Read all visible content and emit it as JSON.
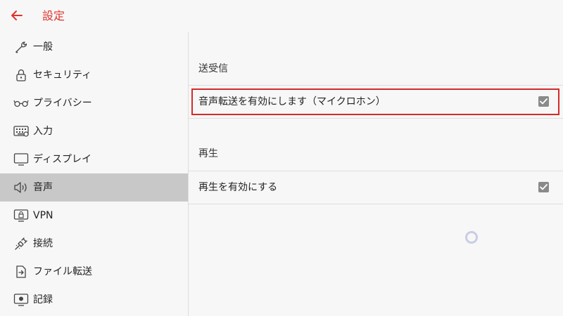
{
  "header": {
    "title": "設定",
    "back_icon": "arrow-left-icon",
    "accent_color": "#e0322b"
  },
  "sidebar": {
    "items": [
      {
        "label": "一般",
        "icon": "wrench-icon",
        "active": false
      },
      {
        "label": "セキュリティ",
        "icon": "lock-icon",
        "active": false
      },
      {
        "label": "プライバシー",
        "icon": "glasses-icon",
        "active": false
      },
      {
        "label": "入力",
        "icon": "keyboard-icon",
        "active": false
      },
      {
        "label": "ディスプレイ",
        "icon": "monitor-icon",
        "active": false
      },
      {
        "label": "音声",
        "icon": "speaker-icon",
        "active": true
      },
      {
        "label": "VPN",
        "icon": "vpn-monitor-icon",
        "active": false
      },
      {
        "label": "接続",
        "icon": "plug-icon",
        "active": false
      },
      {
        "label": "ファイル転送",
        "icon": "file-transfer-icon",
        "active": false
      },
      {
        "label": "記録",
        "icon": "record-icon",
        "active": false
      }
    ]
  },
  "main": {
    "sections": [
      {
        "title": "送受信",
        "rows": [
          {
            "label": "音声転送を有効にします（マイクロホン）",
            "checked": true
          }
        ]
      },
      {
        "title": "再生",
        "rows": [
          {
            "label": "再生を有効にする",
            "checked": true
          }
        ]
      }
    ]
  }
}
